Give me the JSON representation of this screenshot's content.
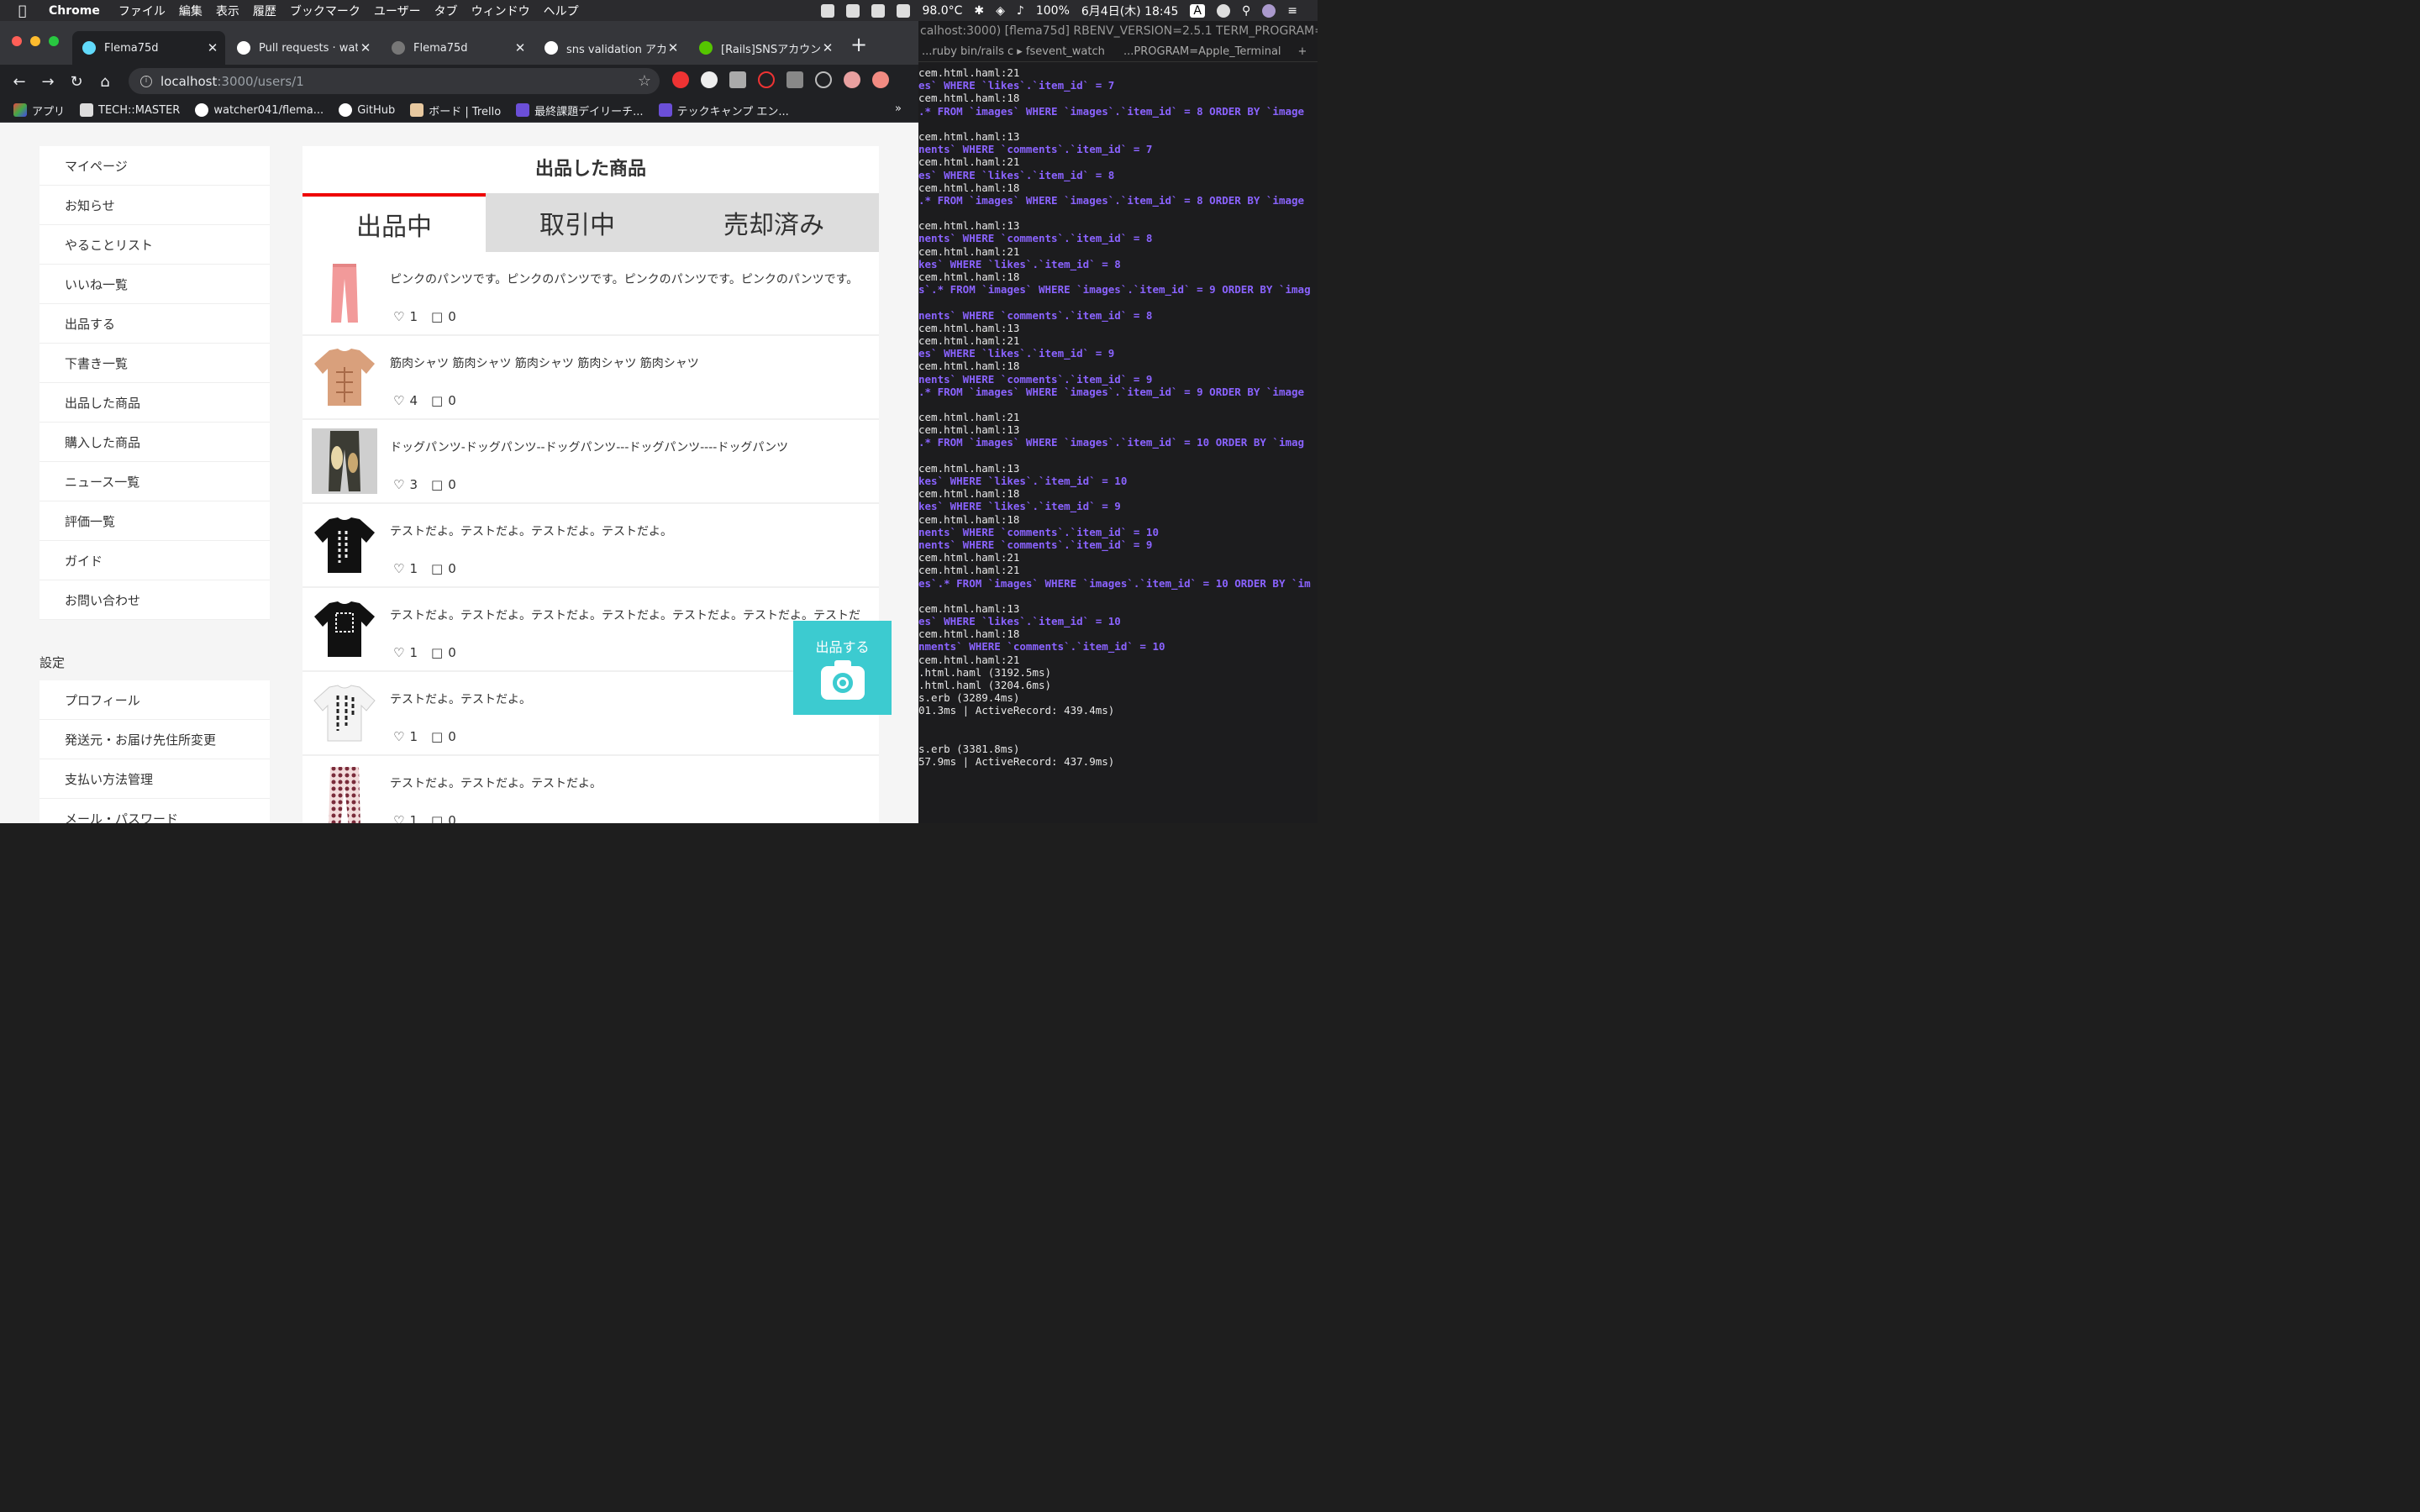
{
  "menubar": {
    "app": "Chrome",
    "items": [
      "ファイル",
      "編集",
      "表示",
      "履歴",
      "ブックマーク",
      "ユーザー",
      "タブ",
      "ウィンドウ",
      "ヘルプ"
    ],
    "temp": "98.0°C",
    "battery": "100%",
    "datetime": "6月4日(木) 18:45",
    "input_mode": "A"
  },
  "tabs": [
    {
      "title": "Flema75d",
      "active": true
    },
    {
      "title": "Pull requests · wat",
      "active": false
    },
    {
      "title": "Flema75d",
      "active": false
    },
    {
      "title": "sns validation アカ",
      "active": false
    },
    {
      "title": "[Rails]SNSアカウン",
      "active": false
    }
  ],
  "address": {
    "host": "localhost",
    "path": ":3000/users/1"
  },
  "bookmarks": [
    "アプリ",
    "TECH::MASTER",
    "watcher041/flema...",
    "GitHub",
    "ボード | Trello",
    "最終課題デイリーチ...",
    "テックキャンプ エン..."
  ],
  "bookmarks_more": "»",
  "sidebar": {
    "items": [
      "マイページ",
      "お知らせ",
      "やることリスト",
      "いいね一覧",
      "出品する",
      "下書き一覧",
      "出品した商品",
      "購入した商品",
      "ニュース一覧",
      "評価一覧",
      "ガイド",
      "お問い合わせ"
    ],
    "settings_heading": "設定",
    "settings_items": [
      "プロフィール",
      "発送元・お届け先住所変更",
      "支払い方法管理",
      "メール・パスワード"
    ]
  },
  "main": {
    "title": "出品した商品",
    "tabs": [
      "出品中",
      "取引中",
      "売却済み"
    ],
    "items": [
      {
        "desc": "ピンクのパンツです。ピンクのパンツです。ピンクのパンツです。ピンクのパンツです。",
        "likes": "1",
        "comments": "0",
        "thumb": "pink-pants"
      },
      {
        "desc": "筋肉シャツ 筋肉シャツ 筋肉シャツ 筋肉シャツ 筋肉シャツ",
        "likes": "4",
        "comments": "0",
        "thumb": "muscle-shirt"
      },
      {
        "desc": "ドッグパンツ-ドッグパンツ--ドッグパンツ---ドッグパンツ----ドッグパンツ",
        "likes": "3",
        "comments": "0",
        "thumb": "dog-pants"
      },
      {
        "desc": "テストだよ。テストだよ。テストだよ。テストだよ。",
        "likes": "1",
        "comments": "0",
        "thumb": "black-tshirt"
      },
      {
        "desc": "テストだよ。テストだよ。テストだよ。テストだよ。テストだよ。テストだよ。テストだ",
        "likes": "1",
        "comments": "0",
        "thumb": "black-tshirt-2"
      },
      {
        "desc": "テストだよ。テストだよ。",
        "likes": "1",
        "comments": "0",
        "thumb": "white-tshirt"
      },
      {
        "desc": "テストだよ。テストだよ。テストだよ。",
        "likes": "1",
        "comments": "0",
        "thumb": "pattern-pants"
      }
    ],
    "sell_button": "出品する"
  },
  "terminal": {
    "title": "calhost:3000) [flema75d] RBENV_VERSION=2.5.1 TERM_PROGRAM=A...",
    "tabs": [
      "...ruby bin/rails c ▸ fsevent_watch",
      "...PROGRAM=Apple_Terminal"
    ],
    "lines": [
      {
        "t": "cem.html.haml:21",
        "s": false
      },
      {
        "t": "es` WHERE `likes`.`item_id` = 7",
        "s": true
      },
      {
        "t": "cem.html.haml:18",
        "s": false
      },
      {
        "t": ".* FROM `images` WHERE `images`.`item_id` = 8 ORDER BY `image",
        "s": true
      },
      {
        "t": "",
        "s": false
      },
      {
        "t": "cem.html.haml:13",
        "s": false
      },
      {
        "t": "nents` WHERE `comments`.`item_id` = 7",
        "s": true
      },
      {
        "t": "cem.html.haml:21",
        "s": false
      },
      {
        "t": "es` WHERE `likes`.`item_id` = 8",
        "s": true
      },
      {
        "t": "cem.html.haml:18",
        "s": false
      },
      {
        "t": ".* FROM `images` WHERE `images`.`item_id` = 8 ORDER BY `image",
        "s": true
      },
      {
        "t": "",
        "s": false
      },
      {
        "t": "cem.html.haml:13",
        "s": false
      },
      {
        "t": "nents` WHERE `comments`.`item_id` = 8",
        "s": true
      },
      {
        "t": "cem.html.haml:21",
        "s": false
      },
      {
        "t": "kes` WHERE `likes`.`item_id` = 8",
        "s": true
      },
      {
        "t": "cem.html.haml:18",
        "s": false
      },
      {
        "t": "s`.* FROM `images` WHERE `images`.`item_id` = 9 ORDER BY `imag",
        "s": true
      },
      {
        "t": "",
        "s": false
      },
      {
        "t": "nents` WHERE `comments`.`item_id` = 8",
        "s": true
      },
      {
        "t": "cem.html.haml:13",
        "s": false
      },
      {
        "t": "cem.html.haml:21",
        "s": false
      },
      {
        "t": "es` WHERE `likes`.`item_id` = 9",
        "s": true
      },
      {
        "t": "cem.html.haml:18",
        "s": false
      },
      {
        "t": "nents` WHERE `comments`.`item_id` = 9",
        "s": true
      },
      {
        "t": ".* FROM `images` WHERE `images`.`item_id` = 9 ORDER BY `image",
        "s": true
      },
      {
        "t": "",
        "s": false
      },
      {
        "t": "cem.html.haml:21",
        "s": false
      },
      {
        "t": "cem.html.haml:13",
        "s": false
      },
      {
        "t": ".* FROM `images` WHERE `images`.`item_id` = 10 ORDER BY `imag",
        "s": true
      },
      {
        "t": "",
        "s": false
      },
      {
        "t": "cem.html.haml:13",
        "s": false
      },
      {
        "t": "kes` WHERE `likes`.`item_id` = 10",
        "s": true
      },
      {
        "t": "cem.html.haml:18",
        "s": false
      },
      {
        "t": "kes` WHERE `likes`.`item_id` = 9",
        "s": true
      },
      {
        "t": "cem.html.haml:18",
        "s": false
      },
      {
        "t": "nents` WHERE `comments`.`item_id` = 10",
        "s": true
      },
      {
        "t": "nents` WHERE `comments`.`item_id` = 9",
        "s": true
      },
      {
        "t": "cem.html.haml:21",
        "s": false
      },
      {
        "t": "cem.html.haml:21",
        "s": false
      },
      {
        "t": "es`.* FROM `images` WHERE `images`.`item_id` = 10 ORDER BY `im",
        "s": true
      },
      {
        "t": "",
        "s": false
      },
      {
        "t": "cem.html.haml:13",
        "s": false
      },
      {
        "t": "es` WHERE `likes`.`item_id` = 10",
        "s": true
      },
      {
        "t": "cem.html.haml:18",
        "s": false
      },
      {
        "t": "nments` WHERE `comments`.`item_id` = 10",
        "s": true
      },
      {
        "t": "cem.html.haml:21",
        "s": false
      },
      {
        "t": ".html.haml (3192.5ms)",
        "s": false
      },
      {
        "t": ".html.haml (3204.6ms)",
        "s": false
      },
      {
        "t": "s.erb (3289.4ms)",
        "s": false
      },
      {
        "t": "01.3ms | ActiveRecord: 439.4ms)",
        "s": false
      },
      {
        "t": "",
        "s": false
      },
      {
        "t": "",
        "s": false
      },
      {
        "t": "s.erb (3381.8ms)",
        "s": false
      },
      {
        "t": "57.9ms | ActiveRecord: 437.9ms)",
        "s": false
      }
    ]
  },
  "colors": {
    "accent_red": "#e00000",
    "sell_button": "#3ccbd0"
  }
}
